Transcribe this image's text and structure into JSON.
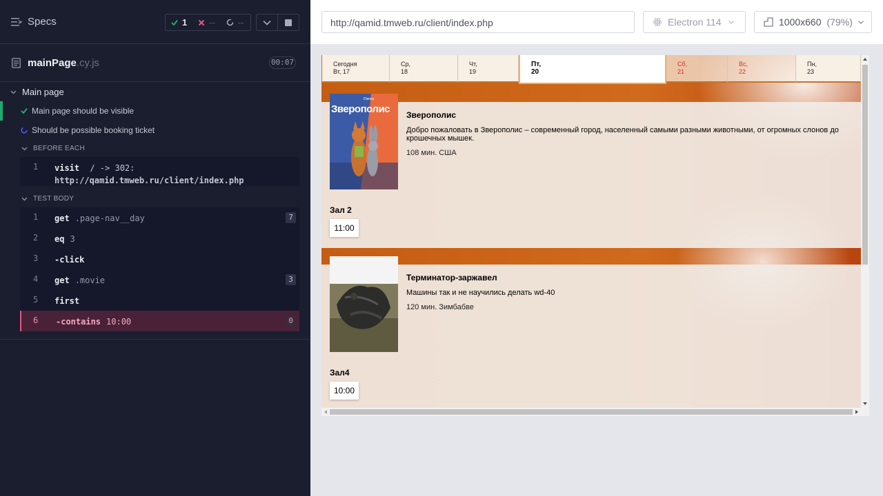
{
  "reporter": {
    "specs_label": "Specs",
    "stats": {
      "passed": "1",
      "failed": "--",
      "pending": "--"
    },
    "spec_file": {
      "name": "mainPage",
      "ext": ".cy.js",
      "duration": "00:07"
    },
    "suite_title": "Main page",
    "tests": [
      {
        "title": "Main page should be visible",
        "state": "passed"
      },
      {
        "title": "Should be possible booking ticket",
        "state": "running"
      }
    ],
    "before_each": {
      "title": "BEFORE EACH",
      "commands": [
        {
          "num": "1",
          "name": "visit",
          "line1": "/ -> 302:",
          "line2": "http://qamid.tmweb.ru/client/index.php"
        }
      ]
    },
    "test_body": {
      "title": "TEST BODY",
      "commands": [
        {
          "num": "1",
          "name": "get",
          "arg": ".page-nav__day",
          "badge": "7"
        },
        {
          "num": "2",
          "name": "eq",
          "arg": "3"
        },
        {
          "num": "3",
          "name": "-click",
          "arg": ""
        },
        {
          "num": "4",
          "name": "get",
          "arg": ".movie",
          "badge": "3"
        },
        {
          "num": "5",
          "name": "first",
          "arg": ""
        },
        {
          "num": "6",
          "name": "-contains",
          "arg": "10:00",
          "badge": "0"
        }
      ]
    }
  },
  "aut_header": {
    "url": "http://qamid.tmweb.ru/client/index.php",
    "browser": "Electron 114",
    "viewport": "1000x660",
    "zoom": "(79%)"
  },
  "app": {
    "days": [
      {
        "week": "Сегодня",
        "date": "Вт, 17"
      },
      {
        "week": "Ср,",
        "date": "18"
      },
      {
        "week": "Чт,",
        "date": "19"
      },
      {
        "week": "Пт,",
        "date": "20"
      },
      {
        "week": "Сб,",
        "date": "21"
      },
      {
        "week": "Вс,",
        "date": "22"
      },
      {
        "week": "Пн,",
        "date": "23"
      }
    ],
    "movies": [
      {
        "poster_text": "Зверополис",
        "title": "Зверополис",
        "description": "Добро пожаловать в Зверополис – современный город, населенный самыми разными животными, от огромных слонов до крошечных мышек.",
        "meta": "108 мин. США",
        "hall": "Зал 2",
        "seance": "11:00"
      },
      {
        "title": "Терминатор-заржавел",
        "description": "Машины так и не научились делать wd-40",
        "meta": "120 мин. Зимбабве",
        "hall": "Зал4",
        "seance": "10:00"
      }
    ]
  },
  "colors": {
    "accent_pass": "#1fa971",
    "accent_fail": "#e0578b",
    "weekend": "#d0332b"
  }
}
